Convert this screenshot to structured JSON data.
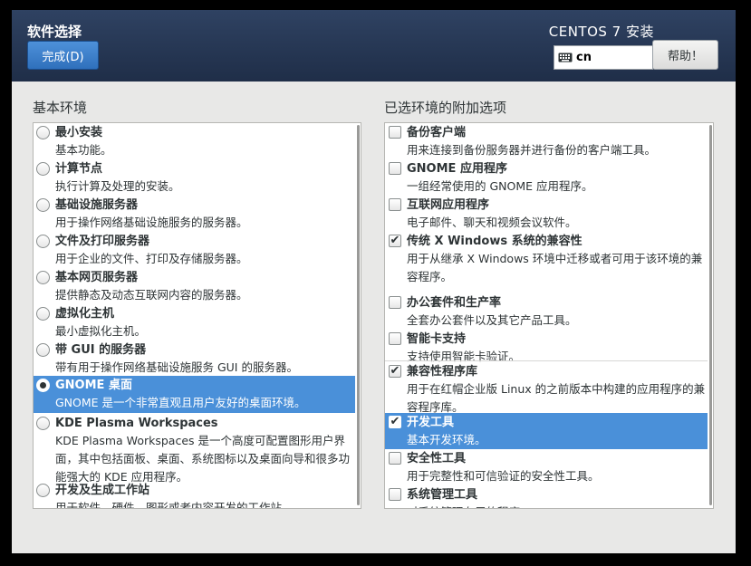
{
  "header": {
    "title": "软件选择",
    "done_label": "完成(D)",
    "product": "CENTOS 7 安装",
    "keyboard_layout": "cn",
    "help_label": "帮助！"
  },
  "base_env": {
    "label": "基本环境",
    "items": [
      {
        "name": "最小安装",
        "desc": "基本功能。",
        "selected": false
      },
      {
        "name": "计算节点",
        "desc": "执行计算及处理的安装。",
        "selected": false
      },
      {
        "name": "基础设施服务器",
        "desc": "用于操作网络基础设施服务的服务器。",
        "selected": false
      },
      {
        "name": "文件及打印服务器",
        "desc": "用于企业的文件、打印及存储服务器。",
        "selected": false
      },
      {
        "name": "基本网页服务器",
        "desc": "提供静态及动态互联网内容的服务器。",
        "selected": false
      },
      {
        "name": "虚拟化主机",
        "desc": "最小虚拟化主机。",
        "selected": false
      },
      {
        "name": "带 GUI 的服务器",
        "desc": "带有用于操作网络基础设施服务 GUI 的服务器。",
        "selected": false
      },
      {
        "name": "GNOME 桌面",
        "desc": "GNOME 是一个非常直观且用户友好的桌面环境。",
        "selected": true
      },
      {
        "name": "KDE Plasma Workspaces",
        "desc": "KDE Plasma Workspaces 是一个高度可配置图形用户界面，其中包括面板、桌面、系统图标以及桌面向导和很多功能强大的 KDE 应用程序。",
        "selected": false
      },
      {
        "name": "开发及生成工作站",
        "desc": "用于软件、硬件、图形或者内容开发的工作站。",
        "selected": false
      }
    ]
  },
  "addons": {
    "label": "已选环境的附加选项",
    "items": [
      {
        "name": "备份客户端",
        "desc": "用来连接到备份服务器并进行备份的客户端工具。",
        "checked": false,
        "selected": false
      },
      {
        "name": "GNOME 应用程序",
        "desc": "一组经常使用的 GNOME 应用程序。",
        "checked": false,
        "selected": false
      },
      {
        "name": "互联网应用程序",
        "desc": "电子邮件、聊天和视频会议软件。",
        "checked": false,
        "selected": false
      },
      {
        "name": "传统 X Windows 系统的兼容性",
        "desc": "用于从继承 X Windows 环境中迁移或者可用于该环境的兼容程序。",
        "checked": true,
        "selected": false
      },
      {
        "name": "办公套件和生产率",
        "desc": "全套办公套件以及其它产品工具。",
        "checked": false,
        "selected": false
      },
      {
        "name": "智能卡支持",
        "desc": "支持使用智能卡验证。",
        "checked": false,
        "selected": false
      },
      {
        "name": "兼容性程序库",
        "desc": "用于在红帽企业版 Linux 的之前版本中构建的应用程序的兼容程序库。",
        "checked": true,
        "selected": false
      },
      {
        "name": "开发工具",
        "desc": "基本开发环境。",
        "checked": true,
        "selected": true
      },
      {
        "name": "安全性工具",
        "desc": "用于完整性和可信验证的安全性工具。",
        "checked": false,
        "selected": false
      },
      {
        "name": "系统管理工具",
        "desc": "对系统管理有用的程序。",
        "checked": false,
        "selected": false
      }
    ]
  },
  "icons": {
    "keyboard": "keyboard-icon",
    "check": "check-icon"
  }
}
